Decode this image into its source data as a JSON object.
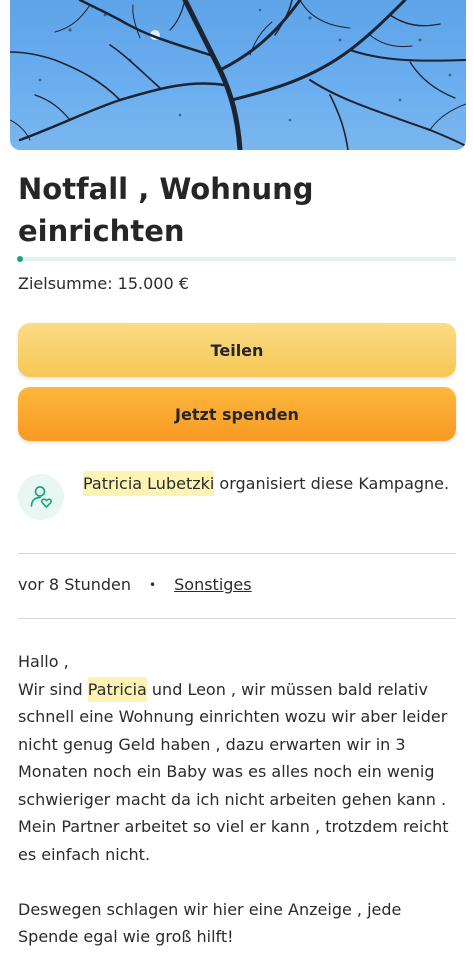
{
  "campaign": {
    "title": "Notfall , Wohnung einrichten",
    "progress_fraction": 0.005,
    "target_text": "Zielsumme: 15.000 €"
  },
  "actions": {
    "share_label": "Teilen",
    "donate_label": "Jetzt spenden"
  },
  "organizer": {
    "name": "Patricia Lubetzki",
    "suffix": " organisiert diese Kampagne."
  },
  "meta": {
    "time": "vor 8 Stunden",
    "separator": "•",
    "category": "Sonstiges"
  },
  "story": {
    "greeting": "Hallo ,",
    "p1_before": "Wir sind ",
    "p1_highlight": "Patricia",
    "p1_after": " und Leon , wir müssen bald relativ schnell eine Wohnung einrichten wozu wir aber leider nicht genug Geld haben , dazu erwarten wir in 3 Monaten noch ein Baby was es alles noch ein wenig schwieriger macht da ich nicht arbeiten gehen kann . Mein Partner arbeitet so viel er kann , trotzdem reicht es einfach nicht.",
    "p2": "Deswegen schlagen wir hier eine Anzeige , jede Spende egal wie groß hilft!"
  },
  "colors": {
    "accent_green": "#13a77d",
    "share_yellow": "#f6c757",
    "donate_orange": "#f79a23",
    "highlight": "#fcf3b4"
  }
}
